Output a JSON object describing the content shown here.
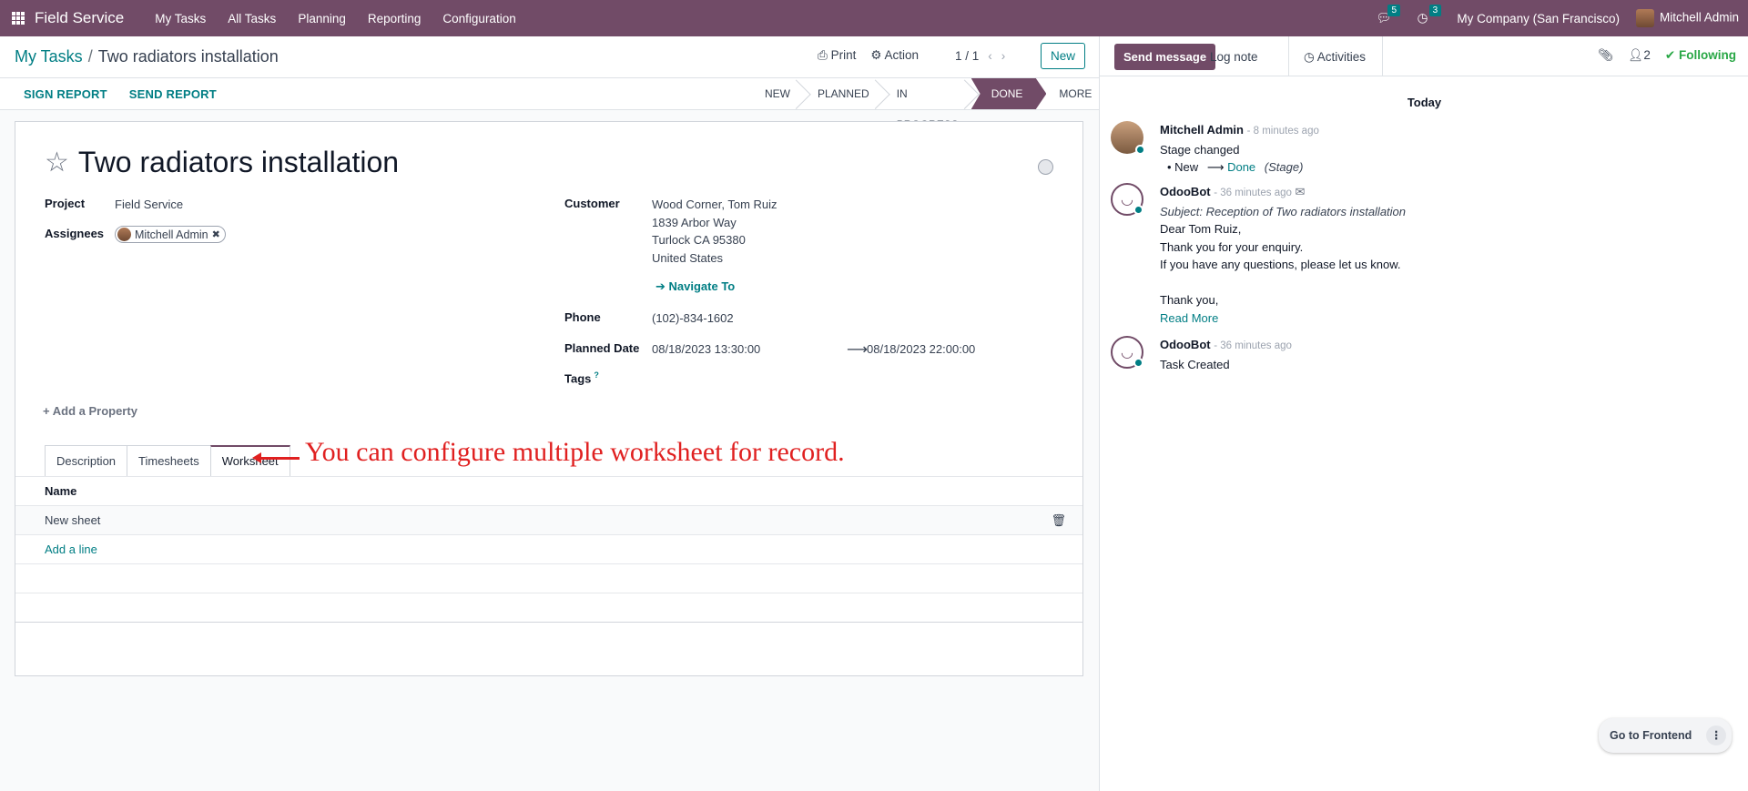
{
  "navbar": {
    "app_name": "Field Service",
    "menu": [
      "My Tasks",
      "All Tasks",
      "Planning",
      "Reporting",
      "Configuration"
    ],
    "messages_count": "5",
    "activities_count": "3",
    "company": "My Company (San Francisco)",
    "user": "Mitchell Admin"
  },
  "breadcrumb": {
    "parent": "My Tasks",
    "current": "Two radiators installation"
  },
  "control": {
    "print": "Print",
    "action": "Action",
    "pager": "1 / 1",
    "new": "New"
  },
  "statusbar": {
    "buttons": [
      "SIGN REPORT",
      "SEND REPORT"
    ],
    "stages": [
      "NEW",
      "PLANNED",
      "IN PROGRESS",
      "DONE"
    ],
    "active_stage": "DONE",
    "more": "MORE"
  },
  "form": {
    "title": "Two radiators installation",
    "project_label": "Project",
    "project": "Field Service",
    "assignees_label": "Assignees",
    "assignee": "Mitchell Admin",
    "customer_label": "Customer",
    "customer_lines": [
      "Wood Corner, Tom Ruiz",
      "1839 Arbor Way",
      "Turlock CA 95380",
      "United States"
    ],
    "navigate": "Navigate To",
    "phone_label": "Phone",
    "phone": "(102)-834-1602",
    "planned_label": "Planned Date",
    "planned_start": "08/18/2023 13:30:00",
    "planned_end": "08/18/2023 22:00:00",
    "tags_label": "Tags",
    "tags_help": "?",
    "add_property": "Add a Property",
    "tabs": [
      "Description",
      "Timesheets",
      "Worksheet"
    ],
    "active_tab": "Worksheet",
    "annotation": "You can configure multiple worksheet for record.",
    "table_header": "Name",
    "rows": [
      "New sheet"
    ],
    "add_line": "Add a line"
  },
  "chatter": {
    "send_message": "Send message",
    "log_note": "Log note",
    "activities": "Activities",
    "followers": "2",
    "following": "Following",
    "date_sep": "Today",
    "messages": [
      {
        "author": "Mitchell Admin",
        "when": "- 8 minutes ago",
        "line1": "Stage changed",
        "from": "New",
        "to": "Done",
        "field": "(Stage)"
      },
      {
        "author": "OdooBot",
        "when": "- 36 minutes ago",
        "subject": "Subject: Reception of Two radiators installation",
        "lines": [
          "Dear Tom Ruiz,",
          "Thank you for your enquiry.",
          "If you have any questions, please let us know.",
          "",
          "Thank you,"
        ],
        "read_more": "Read More"
      },
      {
        "author": "OdooBot",
        "when": "- 36 minutes ago",
        "line1": "Task Created"
      }
    ]
  },
  "frontend_button": "Go to Frontend",
  "colors": {
    "brand": "#714b67",
    "accent": "#017e84",
    "following": "#28a745",
    "annotation": "#e02020"
  }
}
